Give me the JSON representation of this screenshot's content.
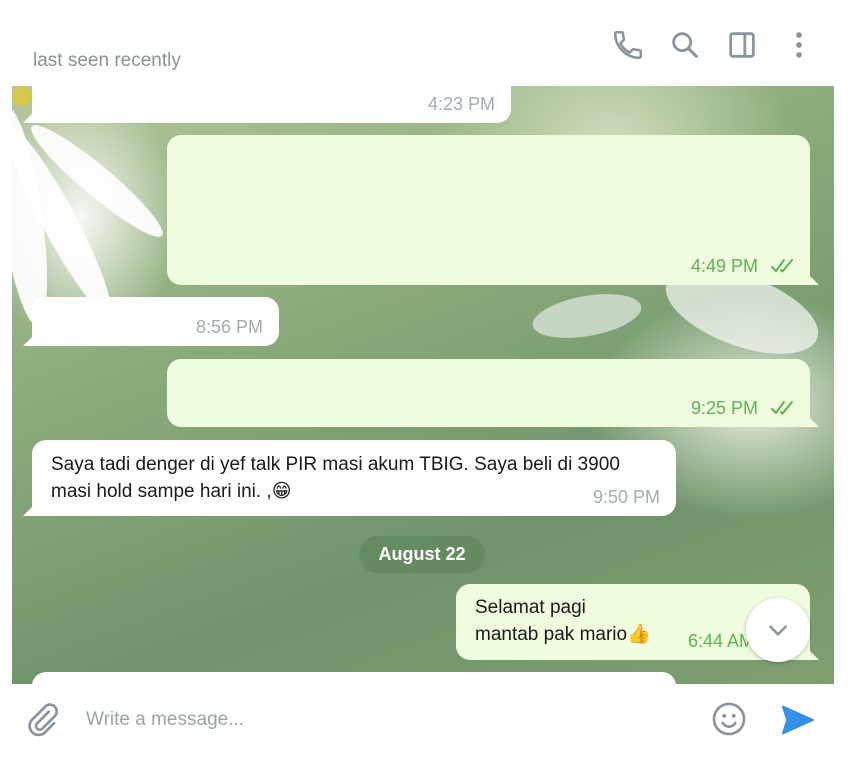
{
  "header": {
    "status": "last seen recently",
    "icons": [
      "phone-icon",
      "search-icon",
      "sidebar-toggle-icon",
      "more-vertical-icon"
    ]
  },
  "messages": [
    {
      "direction": "in",
      "text": "",
      "time": "4:23 PM"
    },
    {
      "direction": "out",
      "text": "",
      "time": "4:49 PM",
      "read": true
    },
    {
      "direction": "in",
      "text": "",
      "time": "8:56 PM"
    },
    {
      "direction": "out",
      "text": "",
      "time": "9:25 PM",
      "read": true
    },
    {
      "direction": "in",
      "text_lines": [
        "Saya tadi denger di yef talk PIR masi akum TBIG. Saya beli di 3900",
        "masi hold sampe hari ini. ,"
      ],
      "emoji": "😁",
      "time": "9:50 PM"
    },
    {
      "direction": "out",
      "text_lines": [
        "Selamat pagi",
        "mantab pak mario"
      ],
      "emoji": "👍",
      "time": "6:44 AM"
    }
  ],
  "date_separator": "August 22",
  "composer": {
    "placeholder": "Write a message...",
    "value": ""
  },
  "colors": {
    "outgoing_bubble": "#effdde",
    "incoming_bubble": "#ffffff",
    "accent": "#3390ec",
    "read_check": "#5eb159"
  }
}
